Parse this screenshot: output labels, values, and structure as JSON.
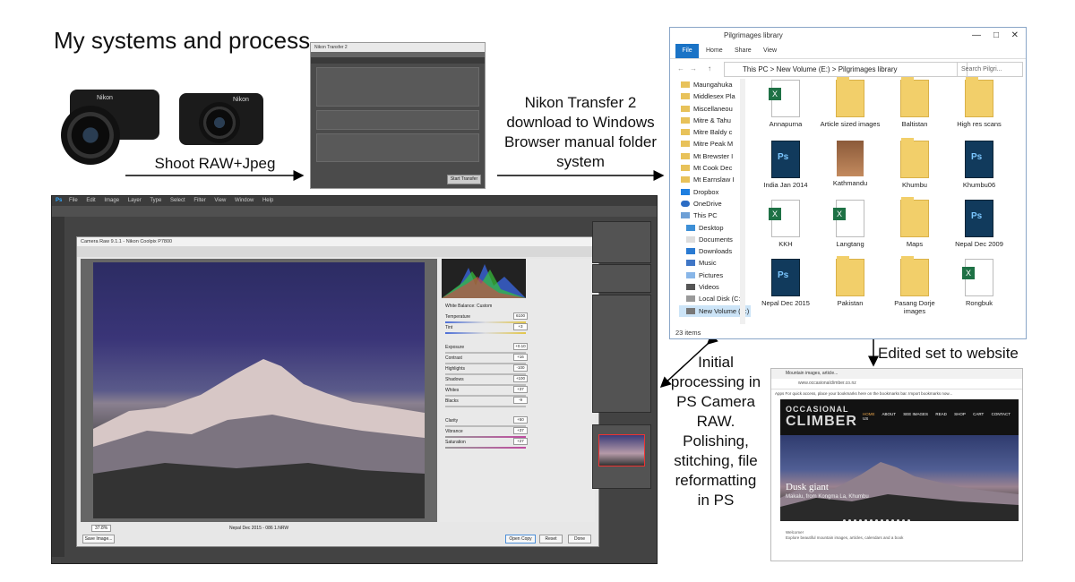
{
  "title": "My systems and process",
  "steps": {
    "shoot": "Shoot RAW+Jpeg",
    "transfer": [
      "Nikon Transfer 2",
      "download to Windows",
      "Browser manual folder",
      "system"
    ],
    "website": "Edited set to website",
    "processing": [
      "Initial",
      "processing in",
      "PS Camera",
      "RAW.",
      "Polishing,",
      "stitching, file",
      "reformatting",
      "in PS"
    ]
  },
  "cameras": {
    "dslr_brand": "Nikon",
    "compact_brand": "Nikon"
  },
  "nikon_transfer": {
    "title": "Nikon Transfer 2",
    "button": "Start Transfer"
  },
  "explorer": {
    "title": "Pilgrimages library",
    "ribbon_tabs": [
      "File",
      "Home",
      "Share",
      "View"
    ],
    "address": "This PC  >  New Volume (E:)  >  Pilgrimages library",
    "search_placeholder": "Search Pilgri...",
    "nav_items": [
      "Maungahuka",
      "Middlesex Pla",
      "Miscellaneou",
      "Mitre & Tahu",
      "Mitre Baldy c",
      "Mitre Peak M",
      "Mt Brewster I",
      "Mt Cook Dec",
      "Mt Earnslaw I",
      "Dropbox",
      "OneDrive",
      "This PC",
      "Desktop",
      "Documents",
      "Downloads",
      "Music",
      "Pictures",
      "Videos",
      "Local Disk (C:)",
      "New Volume (E:)"
    ],
    "files": [
      {
        "name": "Annapurna",
        "kind": "xls"
      },
      {
        "name": "Article sized images",
        "kind": "folder"
      },
      {
        "name": "Baltistan",
        "kind": "folder"
      },
      {
        "name": "High res scans",
        "kind": "folder"
      },
      {
        "name": "India Jan 2014",
        "kind": "ps"
      },
      {
        "name": "Kathmandu",
        "kind": "photo"
      },
      {
        "name": "Khumbu",
        "kind": "folder"
      },
      {
        "name": "Khumbu06",
        "kind": "ps"
      },
      {
        "name": "KKH",
        "kind": "xls"
      },
      {
        "name": "Langtang",
        "kind": "xls"
      },
      {
        "name": "Maps",
        "kind": "folder"
      },
      {
        "name": "Nepal Dec 2009",
        "kind": "ps"
      },
      {
        "name": "Nepal Dec 2015",
        "kind": "ps"
      },
      {
        "name": "Pakistan",
        "kind": "folder"
      },
      {
        "name": "Pasang Dorje images",
        "kind": "folder"
      },
      {
        "name": "Rongbuk",
        "kind": "xls"
      }
    ],
    "status": "23 items"
  },
  "photoshop": {
    "menu": [
      "Ps",
      "File",
      "Edit",
      "Image",
      "Layer",
      "Type",
      "Select",
      "Filter",
      "View",
      "Window",
      "Help"
    ],
    "camera_raw_title": "Camera Raw 9.1.1 - Nikon Coolpix P7800",
    "white_balance": "Custom",
    "sliders": [
      {
        "label": "Temperature",
        "value": "6100"
      },
      {
        "label": "Tint",
        "value": "+3"
      },
      {
        "label": "Exposure",
        "value": "+0.10"
      },
      {
        "label": "Contrast",
        "value": "+16"
      },
      {
        "label": "Highlights",
        "value": "-100"
      },
      {
        "label": "Shadows",
        "value": "+100"
      },
      {
        "label": "Whites",
        "value": "+37"
      },
      {
        "label": "Blacks",
        "value": "-9"
      },
      {
        "label": "Clarity",
        "value": "+50"
      },
      {
        "label": "Vibrance",
        "value": "+37"
      },
      {
        "label": "Saturation",
        "value": "+27"
      }
    ],
    "filename": "Nepal Dec 2015 - 086 1.NRW",
    "buttons": {
      "save": "Save Image...",
      "open": "Open Copy",
      "reset": "Reset",
      "done": "Done"
    },
    "zoom": "37.8%"
  },
  "website": {
    "tab": "Mountain images, article...",
    "url": "www.occasionalclimber.co.nz",
    "bookmarks": "Apps   For quick access, place your bookmarks here on the bookmarks bar. Import bookmarks now...",
    "logo_top": "OCCASIONAL",
    "logo_bottom": "CLIMBER",
    "nav": [
      "HOME",
      "ABOUT",
      "SEE IMAGES",
      "READ",
      "SHOP",
      "CART",
      "CONTACT US"
    ],
    "hero_title": "Dusk giant",
    "hero_sub": "Makalu, from Kongma La, Khumbu",
    "welcome": "Welcome!",
    "body": "Explore beautiful mountain images, articles, calendars and a book"
  },
  "colors": {
    "accent_blue": "#1a73c6",
    "arrow": "#000000"
  }
}
